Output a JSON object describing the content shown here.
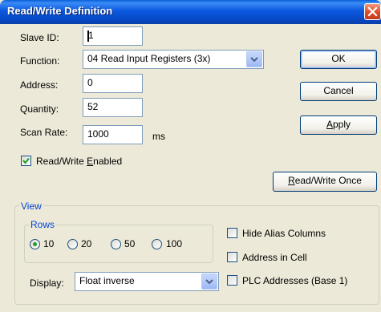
{
  "window": {
    "title": "Read/Write Definition"
  },
  "fields": {
    "slave_id_label": "Slave ID:",
    "slave_id_value": "1",
    "function_label": "Function:",
    "function_value": "04 Read Input Registers (3x)",
    "address_label": "Address:",
    "address_value": "0",
    "quantity_label": "Quantity:",
    "quantity_value": "52",
    "scan_rate_label": "Scan Rate:",
    "scan_rate_value": "1000",
    "scan_rate_unit": "ms"
  },
  "options": {
    "rw_enabled_pre": "Read/Write ",
    "rw_enabled_u": "E",
    "rw_enabled_post": "nabled",
    "rw_enabled_checked": true
  },
  "buttons": {
    "ok": "OK",
    "cancel": "Cancel",
    "apply_u": "A",
    "apply_post": "pply",
    "rw_once_u": "R",
    "rw_once_post": "ead/Write Once"
  },
  "view": {
    "group_label": "View",
    "rows_label": "Rows",
    "rows_options": [
      "10",
      "20",
      "50",
      "100"
    ],
    "rows_selected": "10",
    "display_label": "Display:",
    "display_value": "Float inverse",
    "hide_alias": "Hide Alias Columns",
    "address_in_cell": "Address in Cell",
    "plc_addresses": "PLC Addresses (Base 1)",
    "hide_alias_checked": false,
    "address_in_cell_checked": false,
    "plc_addresses_checked": false
  },
  "colors": {
    "titlebar": "#0a58df",
    "dialog_bg": "#ece9d8",
    "group_label": "#0046d5",
    "radio_dot": "#21a121",
    "check_mark": "#21a121"
  }
}
